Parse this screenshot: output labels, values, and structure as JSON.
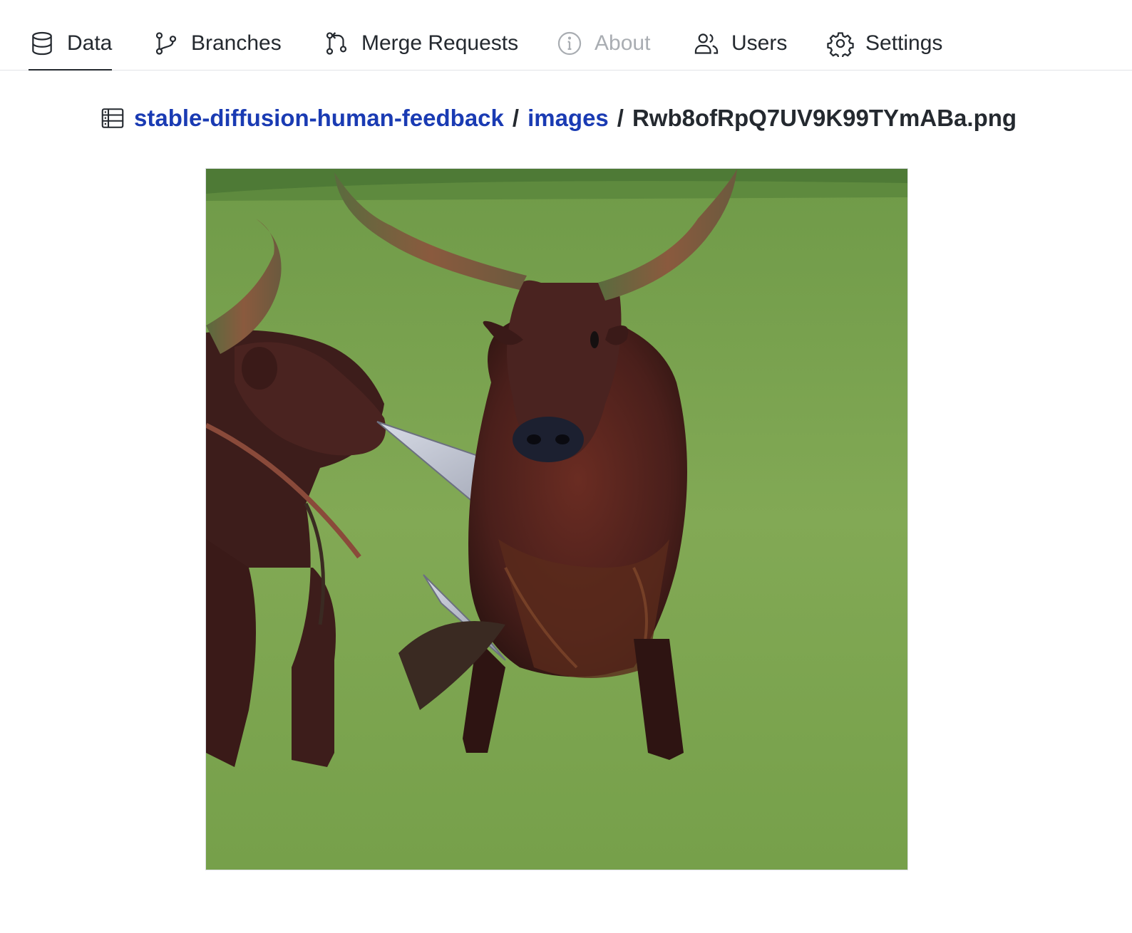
{
  "nav": {
    "items": [
      {
        "id": "data",
        "label": "Data",
        "icon": "database-icon",
        "active": true,
        "disabled": false
      },
      {
        "id": "branches",
        "label": "Branches",
        "icon": "git-branch-icon",
        "active": false,
        "disabled": false
      },
      {
        "id": "merge",
        "label": "Merge Requests",
        "icon": "git-merge-request-icon",
        "active": false,
        "disabled": false
      },
      {
        "id": "about",
        "label": "About",
        "icon": "info-icon",
        "active": false,
        "disabled": true
      },
      {
        "id": "users",
        "label": "Users",
        "icon": "users-icon",
        "active": false,
        "disabled": false
      },
      {
        "id": "settings",
        "label": "Settings",
        "icon": "gear-icon",
        "active": false,
        "disabled": false
      }
    ]
  },
  "breadcrumb": {
    "icon": "table-icon",
    "repo": "stable-diffusion-human-feedback",
    "folder": "images",
    "separator": "/",
    "file": "Rwb8ofRpQ7UV9K99TYmABa.png"
  },
  "viewer": {
    "image_alt": "Two long-horned cattle on a grassy field, one with a blade-like object at its mouth",
    "colors": {
      "grass": "#7da352",
      "cattle": "#4a2320",
      "horn": "#7a5a40",
      "blade": "#b8bcc8"
    }
  },
  "colors": {
    "link": "#1a3bb3",
    "text": "#24292f",
    "disabled": "#a9adb2",
    "divider": "#e2e4e7"
  }
}
